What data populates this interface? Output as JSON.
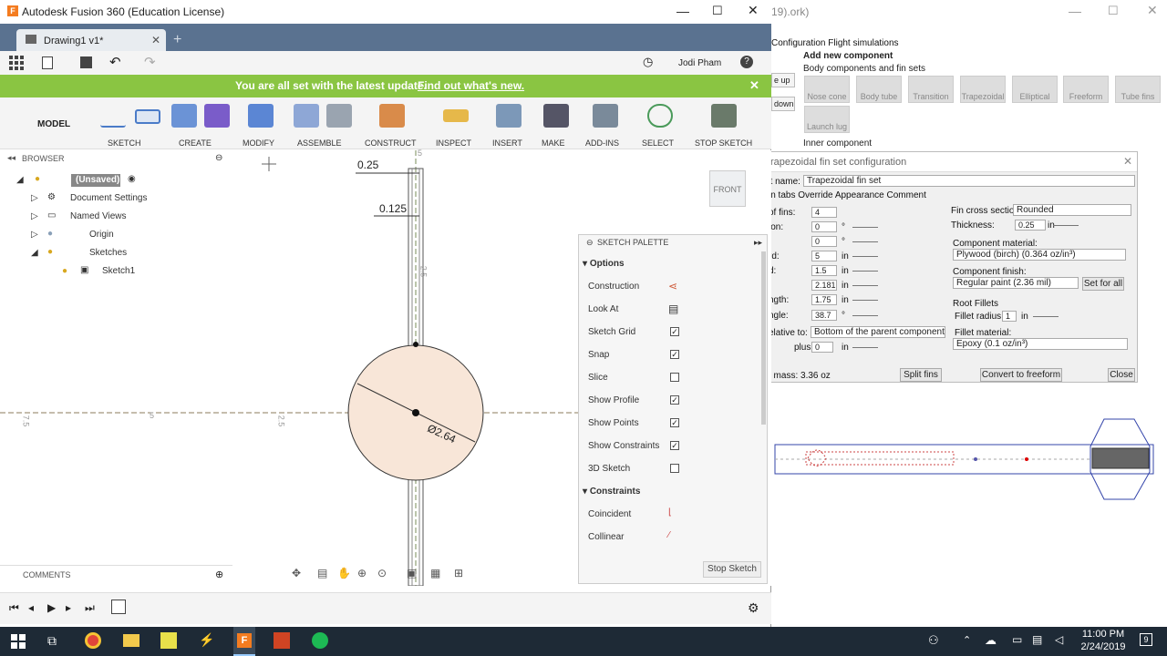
{
  "bg_window": {
    "title": "19).ork)",
    "menu": "Configuration  Flight simulations",
    "add_new_component": "Add new component",
    "body_components_label": "Body components and fin sets",
    "components": [
      "Nose cone",
      "Body tube",
      "Transition",
      "Trapezoidal",
      "Elliptical",
      "Freeform",
      "Tube fins"
    ],
    "launch_lug": "Launch lug",
    "inner_component": "Inner component",
    "side_buttons": [
      "e up",
      "down"
    ]
  },
  "fin_dialog": {
    "title": "rapezoidal fin set configuration",
    "name_label": "nt name:",
    "name_value": "Trapezoidal fin set",
    "tabs": "in tabs  Override  Appearance  Comment",
    "left_rows": [
      {
        "label": "of fins:",
        "value": "4",
        "unit": ""
      },
      {
        "label": "ion:",
        "value": "0",
        "unit": "°"
      },
      {
        "label": "",
        "value": "0",
        "unit": "°"
      },
      {
        "label": "rd:",
        "value": "5",
        "unit": "in"
      },
      {
        "label": "d:",
        "value": "1.5",
        "unit": "in"
      },
      {
        "label": "",
        "value": "2.181",
        "unit": "in"
      },
      {
        "label": "ngth:",
        "value": "1.75",
        "unit": "in"
      },
      {
        "label": "ngle:",
        "value": "38.7",
        "unit": "°"
      }
    ],
    "relative_label": "elative to:",
    "relative_value": "Bottom of the parent component",
    "plus_label": "plus",
    "plus_value": "0",
    "plus_unit": "in",
    "mass": "t mass: 3.36 oz",
    "cross_section_label": "Fin cross section:",
    "cross_section_value": "Rounded",
    "thickness_label": "Thickness:",
    "thickness_value": "0.25",
    "thickness_unit": "in",
    "material_label": "Component material:",
    "material_value": "Plywood (birch) (0.364 oz/in³)",
    "finish_label": "Component finish:",
    "finish_value": "Regular paint (2.36 mil)",
    "set_for_all": "Set for all",
    "root_fillets": "Root Fillets",
    "fillet_radius_label": "Fillet radius:",
    "fillet_radius_value": "1",
    "fillet_radius_unit": "in",
    "fillet_material_label": "Fillet material:",
    "fillet_material_value": "Epoxy (0.1 oz/in³)",
    "split_fins": "Split fins",
    "convert": "Convert to freeform",
    "close": "Close"
  },
  "fusion": {
    "title": "Autodesk Fusion 360 (Education License)",
    "tab_name": "Drawing1 v1*",
    "user": "Jodi Pham",
    "banner_text": "You are all set with the latest update.",
    "banner_link": "Find out what's new.",
    "workspace": "MODEL",
    "toolbar_groups": [
      "SKETCH",
      "CREATE",
      "MODIFY",
      "ASSEMBLE",
      "CONSTRUCT",
      "INSPECT",
      "INSERT",
      "MAKE",
      "ADD-INS",
      "SELECT",
      "STOP SKETCH"
    ],
    "browser_title": "BROWSER",
    "browser_items": [
      "(Unsaved)",
      "Document Settings",
      "Named Views",
      "Origin",
      "Sketches",
      "Sketch1"
    ],
    "comments": "COMMENTS",
    "viewcube": "FRONT",
    "dims": {
      "d1": "0.25",
      "d2": "0.125",
      "dia": "Ø2.64",
      "axis_a": "2.5",
      "axis_b": "5",
      "axis_c": "7.5",
      "axis_d": "2.5",
      "axis_e": "5"
    },
    "palette": {
      "title": "SKETCH PALETTE",
      "options_header": "Options",
      "options": [
        {
          "label": "Construction",
          "type": "icon"
        },
        {
          "label": "Look At",
          "type": "icon"
        },
        {
          "label": "Sketch Grid",
          "checked": true
        },
        {
          "label": "Snap",
          "checked": true
        },
        {
          "label": "Slice",
          "checked": false
        },
        {
          "label": "Show Profile",
          "checked": true
        },
        {
          "label": "Show Points",
          "checked": true
        },
        {
          "label": "Show Constraints",
          "checked": true
        },
        {
          "label": "3D Sketch",
          "checked": false
        }
      ],
      "constraints_header": "Constraints",
      "constraints": [
        "Coincident",
        "Collinear"
      ],
      "stop": "Stop Sketch"
    }
  },
  "taskbar": {
    "time": "11:00 PM",
    "date": "2/24/2019",
    "badge": "9"
  }
}
